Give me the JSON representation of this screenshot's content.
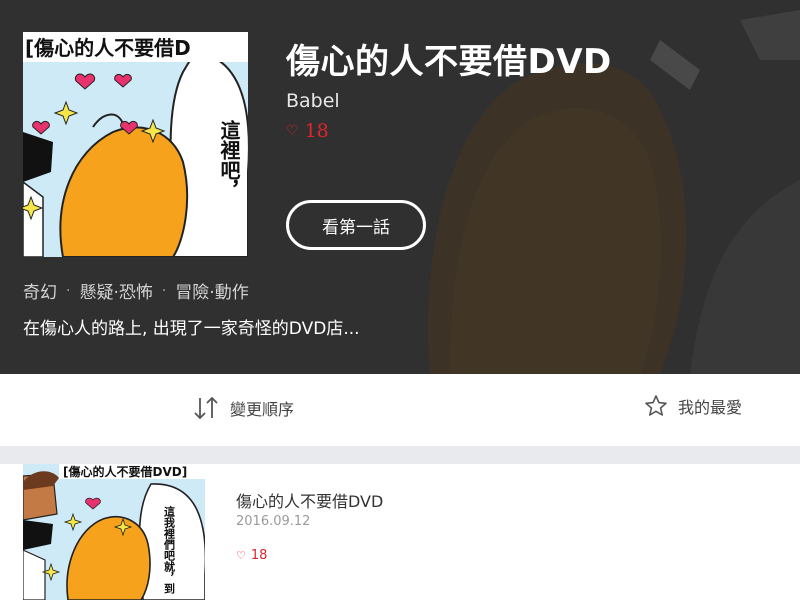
{
  "comic": {
    "title": "傷心的人不要借DVD",
    "author": "Babel",
    "likes": "18",
    "read_button": "看第一話",
    "genres": [
      "奇幻",
      "懸疑·恐怖",
      "冒險·動作"
    ],
    "genre_separator": "·",
    "description": "在傷心人的路上, 出現了一家奇怪的DVD店...",
    "cover_caption": "[傷心的人不要借D",
    "cover_bubble": "這裡吧，"
  },
  "toolbar": {
    "sort_label": "變更順序",
    "sort_icon": "sort-arrows-icon",
    "favorite_label": "我的最愛",
    "favorite_icon": "star-icon"
  },
  "chapters": [
    {
      "title": "傷心的人不要借DVD",
      "date": "2016.09.12",
      "likes": "18",
      "thumb_caption": "[傷心的人不要借DVD]",
      "thumb_bubble": "這我裡們吧就，到"
    }
  ],
  "colors": {
    "like_red": "#e0242b",
    "hero_dark": "#3a3a3a",
    "divider_gray": "#e8eaed"
  }
}
